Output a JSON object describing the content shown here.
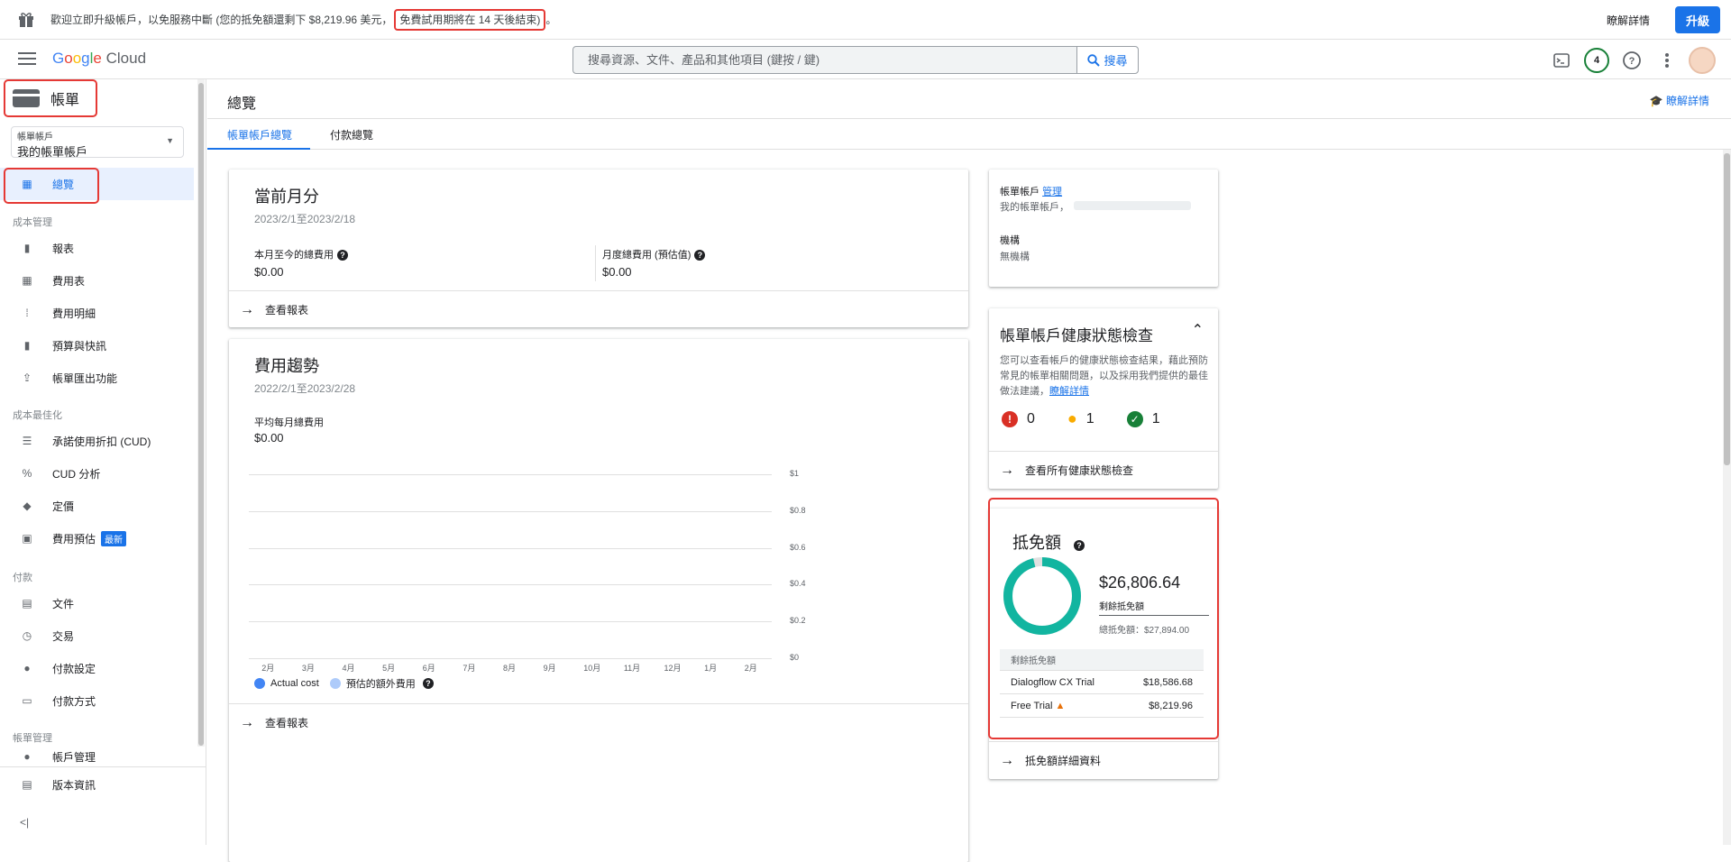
{
  "banner": {
    "message": "歡迎立即升級帳戶，以免服務中斷 (您的抵免額還剩下 $8,219.96 美元，",
    "highlight": "免費試用期將在 14 天後結束)",
    "tail": "。",
    "learn_more": "瞭解詳情",
    "upgrade": "升級"
  },
  "appbar": {
    "logo_google": [
      "G",
      "o",
      "o",
      "g",
      "l",
      "e"
    ],
    "logo_cloud": "Cloud",
    "search_placeholder": "搜尋資源、文件、產品和其他項目 (鍵按 / 鍵)",
    "search_button": "搜尋",
    "notifications_count": "4"
  },
  "sidebar": {
    "title": "帳單",
    "account_label": "帳單帳戶",
    "account_value": "我的帳單帳戶",
    "overview": "總覽",
    "sections": {
      "cost": "成本管理",
      "optimize": "成本最佳化",
      "payment": "付款",
      "billing": "帳單管理"
    },
    "items": {
      "reports": "報表",
      "cost_table": "費用表",
      "cost_breakdown": "費用明細",
      "budgets": "預算與快訊",
      "export": "帳單匯出功能",
      "cud": "承諾使用折扣 (CUD)",
      "cud_analysis": "CUD 分析",
      "pricing": "定價",
      "forecast": "費用預估",
      "forecast_badge": "最新",
      "documents": "文件",
      "transactions": "交易",
      "payment_settings": "付款設定",
      "payment_method": "付款方式",
      "account_mgmt": "帳戶管理"
    },
    "release_notes": "版本資訊",
    "collapse": "<|"
  },
  "page": {
    "title": "總覽",
    "learn_more": "瞭解詳情",
    "tabs": [
      "帳單帳戶總覽",
      "付款總覽"
    ]
  },
  "current_month": {
    "title": "當前月分",
    "range": "2023/2/1至2023/2/18",
    "mtd_label": "本月至今的總費用",
    "mtd_value": "$0.00",
    "forecast_label": "月度總費用 (預估值)",
    "forecast_value": "$0.00",
    "link": "查看報表"
  },
  "cost_trend": {
    "title": "費用趨勢",
    "range": "2022/2/1至2023/2/28",
    "avg_label": "平均每月總費用",
    "avg_value": "$0.00",
    "legend_actual": "Actual cost",
    "legend_forecast": "預估的額外費用",
    "link": "查看報表"
  },
  "chart_data": {
    "type": "bar",
    "categories": [
      "2月",
      "3月",
      "4月",
      "5月",
      "6月",
      "7月",
      "8月",
      "9月",
      "10月",
      "11月",
      "12月",
      "1月",
      "2月"
    ],
    "series": [
      {
        "name": "Actual cost",
        "values": [
          0,
          0,
          0,
          0,
          0,
          0,
          0,
          0,
          0,
          0,
          0,
          0,
          0
        ]
      },
      {
        "name": "預估的額外費用",
        "values": [
          0,
          0,
          0,
          0,
          0,
          0,
          0,
          0,
          0,
          0,
          0,
          0,
          0
        ]
      }
    ],
    "y_ticks": [
      "$1",
      "$0.8",
      "$0.6",
      "$0.4",
      "$0.2",
      "$0"
    ],
    "ylim": [
      0,
      1
    ],
    "colors": {
      "actual": "#4285f4",
      "forecast": "#aecbfa"
    }
  },
  "account_card": {
    "label": "帳單帳戶",
    "manage": "管理",
    "account_name": "我的帳單帳戶，",
    "org_label": "機構",
    "org_value": "無機構"
  },
  "health": {
    "title": "帳單帳戶健康狀態檢查",
    "desc": "您可以查看帳戶的健康狀態檢查結果，藉此預防常見的帳單相關問題，以及採用我們提供的最佳做法建議，",
    "desc_link": "瞭解詳情",
    "errors": "0",
    "warnings": "1",
    "ok": "1",
    "link": "查看所有健康狀態檢查"
  },
  "credits": {
    "title": "抵免額",
    "remaining_value": "$26,806.64",
    "remaining_label": "剩餘抵免額",
    "total": "總抵免額：$27,894.00",
    "remaining_fraction": 0.961,
    "table_header": "剩餘抵免額",
    "rows": [
      {
        "name": "Dialogflow CX Trial",
        "value": "$18,586.68"
      },
      {
        "name": "Free Trial",
        "value": "$8,219.96"
      }
    ],
    "link": "抵免額詳細資料",
    "color": "#12b5a0"
  }
}
